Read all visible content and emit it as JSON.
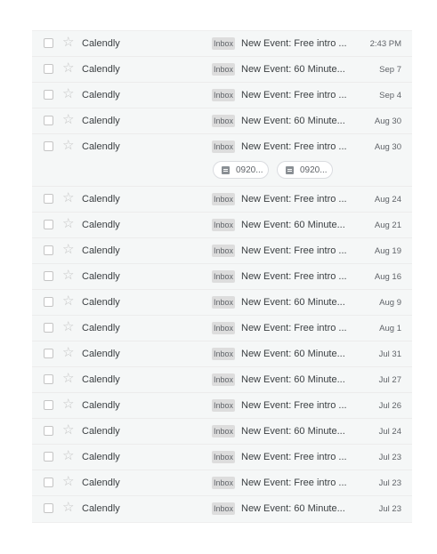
{
  "emails": [
    {
      "sender": "Calendly",
      "label": "Inbox",
      "subject": "New Event: Free intro ...",
      "date": "2:43 PM"
    },
    {
      "sender": "Calendly",
      "label": "Inbox",
      "subject": "New Event: 60 Minute...",
      "date": "Sep 7"
    },
    {
      "sender": "Calendly",
      "label": "Inbox",
      "subject": "New Event: Free intro ...",
      "date": "Sep 4"
    },
    {
      "sender": "Calendly",
      "label": "Inbox",
      "subject": "New Event: 60 Minute...",
      "date": "Aug 30"
    },
    {
      "sender": "Calendly",
      "label": "Inbox",
      "subject": "New Event: Free intro ...",
      "date": "Aug 30",
      "attachments": [
        {
          "name": "0920..."
        },
        {
          "name": "0920..."
        }
      ]
    },
    {
      "sender": "Calendly",
      "label": "Inbox",
      "subject": "New Event: Free intro ...",
      "date": "Aug 24"
    },
    {
      "sender": "Calendly",
      "label": "Inbox",
      "subject": "New Event: 60 Minute...",
      "date": "Aug 21"
    },
    {
      "sender": "Calendly",
      "label": "Inbox",
      "subject": "New Event: Free intro ...",
      "date": "Aug 19"
    },
    {
      "sender": "Calendly",
      "label": "Inbox",
      "subject": "New Event: Free intro ...",
      "date": "Aug 16"
    },
    {
      "sender": "Calendly",
      "label": "Inbox",
      "subject": "New Event: 60 Minute...",
      "date": "Aug 9"
    },
    {
      "sender": "Calendly",
      "label": "Inbox",
      "subject": "New Event: Free intro ...",
      "date": "Aug 1"
    },
    {
      "sender": "Calendly",
      "label": "Inbox",
      "subject": "New Event: 60 Minute...",
      "date": "Jul 31"
    },
    {
      "sender": "Calendly",
      "label": "Inbox",
      "subject": "New Event: 60 Minute...",
      "date": "Jul 27"
    },
    {
      "sender": "Calendly",
      "label": "Inbox",
      "subject": "New Event: Free intro ...",
      "date": "Jul 26"
    },
    {
      "sender": "Calendly",
      "label": "Inbox",
      "subject": "New Event: 60 Minute...",
      "date": "Jul 24"
    },
    {
      "sender": "Calendly",
      "label": "Inbox",
      "subject": "New Event: Free intro ...",
      "date": "Jul 23"
    },
    {
      "sender": "Calendly",
      "label": "Inbox",
      "subject": "New Event: Free intro ...",
      "date": "Jul 23"
    },
    {
      "sender": "Calendly",
      "label": "Inbox",
      "subject": "New Event: 60 Minute...",
      "date": "Jul 23"
    }
  ],
  "icons": {
    "checkbox": "checkbox-icon",
    "star": "star-outline-icon",
    "attachment": "document-icon"
  },
  "colors": {
    "row_background": "#f5f7f7",
    "label_background": "#dddddd",
    "text": "#3c4043",
    "muted": "#5f6368"
  }
}
